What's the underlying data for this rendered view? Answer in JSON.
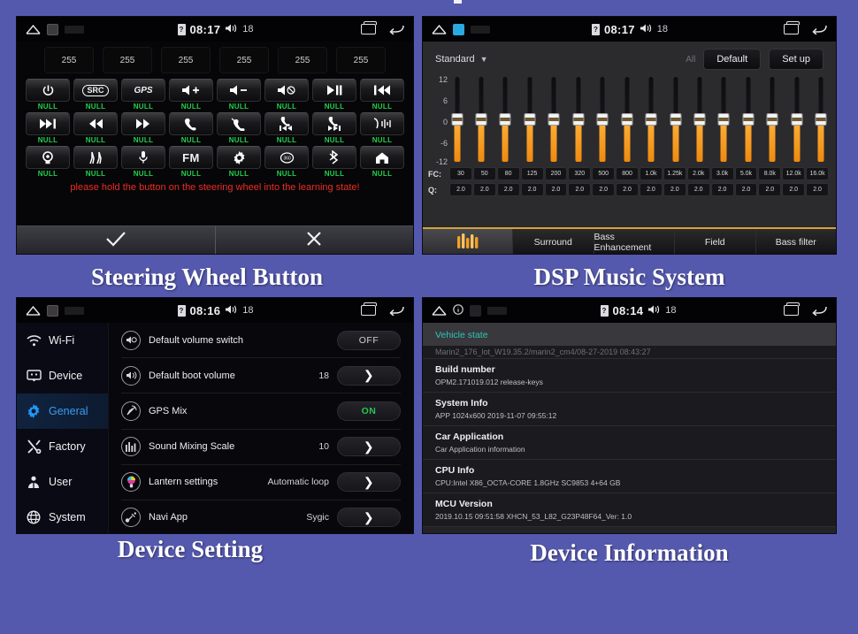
{
  "captions": {
    "steering": "Steering Wheel Button",
    "dsp": "DSP Music System",
    "setting": "Device Setting",
    "info": "Device  Information"
  },
  "status_bars": {
    "p1": {
      "time": "08:17",
      "volume": "18",
      "battery_icon": "battery-icon",
      "home_icon": "home-icon",
      "recent_icon": "recent-apps-icon",
      "back_icon": "back-icon"
    },
    "p2": {
      "time": "08:17",
      "volume": "18"
    },
    "p3": {
      "time": "08:16",
      "volume": "18"
    },
    "p4": {
      "time": "08:14",
      "volume": "18"
    }
  },
  "steering": {
    "values": [
      "255",
      "255",
      "255",
      "255",
      "255",
      "255"
    ],
    "hint": "please hold the button on the steering wheel into the learning state!",
    "null_label": "NULL",
    "buttons": [
      {
        "icon": "power-icon",
        "label": "NULL"
      },
      {
        "icon": "src-icon",
        "label": "NULL"
      },
      {
        "icon": "gps-icon",
        "label": "NULL"
      },
      {
        "icon": "volume-up-icon",
        "label": "NULL"
      },
      {
        "icon": "volume-down-icon",
        "label": "NULL"
      },
      {
        "icon": "volume-mute-icon",
        "label": "NULL"
      },
      {
        "icon": "play-pause-icon",
        "label": "NULL"
      },
      {
        "icon": "previous-track-icon",
        "label": "NULL"
      },
      {
        "icon": "next-track-icon",
        "label": "NULL"
      },
      {
        "icon": "rewind-icon",
        "label": "NULL"
      },
      {
        "icon": "fast-forward-icon",
        "label": "NULL"
      },
      {
        "icon": "phone-answer-icon",
        "label": "NULL"
      },
      {
        "icon": "phone-hangup-icon",
        "label": "NULL"
      },
      {
        "icon": "phone-prev-icon",
        "label": "NULL"
      },
      {
        "icon": "phone-next-icon",
        "label": "NULL"
      },
      {
        "icon": "voice-wave-icon",
        "label": "NULL"
      },
      {
        "icon": "camera-icon",
        "label": "NULL"
      },
      {
        "icon": "seat-icon",
        "label": "NULL"
      },
      {
        "icon": "microphone-icon",
        "label": "NULL"
      },
      {
        "icon": "fm-radio-icon",
        "label": "FM",
        "text": "FM"
      },
      {
        "icon": "settings-gear-icon",
        "label": "NULL"
      },
      {
        "icon": "360-view-icon",
        "label": "NULL"
      },
      {
        "icon": "bluetooth-icon",
        "label": "NULL"
      },
      {
        "icon": "home-house-icon",
        "label": "NULL"
      }
    ],
    "confirm_icon": "check-icon",
    "cancel_icon": "close-icon"
  },
  "dsp": {
    "preset": "Standard",
    "all_label": "All",
    "default_button": "Default",
    "setup_button": "Set up",
    "scale_labels": [
      "12",
      "6",
      "0",
      "-6",
      "-12"
    ],
    "fc_label": "FC:",
    "q_label": "Q:",
    "fc_values": [
      "30",
      "50",
      "80",
      "125",
      "200",
      "320",
      "500",
      "800",
      "1.0k",
      "1.25k",
      "2.0k",
      "3.0k",
      "5.0k",
      "8.0k",
      "12.0k",
      "16.0k"
    ],
    "q_values": [
      "2.0",
      "2.0",
      "2.0",
      "2.0",
      "2.0",
      "2.0",
      "2.0",
      "2.0",
      "2.0",
      "2.0",
      "2.0",
      "2.0",
      "2.0",
      "2.0",
      "2.0",
      "2.0"
    ],
    "band_gains": [
      0,
      0,
      0,
      0,
      0,
      0,
      0,
      0,
      0,
      0,
      0,
      0,
      0,
      0,
      0,
      0
    ],
    "tabs": [
      {
        "label": "",
        "icon": "equalizer-icon",
        "active": true
      },
      {
        "label": "Surround",
        "active": false
      },
      {
        "label": "Bass Enhancement",
        "active": false
      },
      {
        "label": "Field",
        "active": false
      },
      {
        "label": "Bass filter",
        "active": false
      }
    ]
  },
  "device_setting": {
    "sidebar": [
      {
        "label": "Wi-Fi",
        "icon": "wifi-icon",
        "active": false
      },
      {
        "label": "Device",
        "icon": "device-icon",
        "active": false
      },
      {
        "label": "General",
        "icon": "gear-icon",
        "active": true
      },
      {
        "label": "Factory",
        "icon": "tools-icon",
        "active": false
      },
      {
        "label": "User",
        "icon": "user-icon",
        "active": false
      },
      {
        "label": "System",
        "icon": "globe-icon",
        "active": false
      }
    ],
    "rows": [
      {
        "name": "Default volume switch",
        "icon": "volume-mute-circle-icon",
        "value": "",
        "control": "OFF"
      },
      {
        "name": "Default boot volume",
        "icon": "volume-circle-icon",
        "value": "18",
        "control": "chevron"
      },
      {
        "name": "GPS Mix",
        "icon": "gps-circle-icon",
        "value": "",
        "control": "ON"
      },
      {
        "name": "Sound Mixing Scale",
        "icon": "equalizer-circle-icon",
        "value": "10",
        "control": "chevron"
      },
      {
        "name": "Lantern settings",
        "icon": "lantern-circle-icon",
        "value": "Automatic loop",
        "control": "chevron"
      },
      {
        "name": "Navi App",
        "icon": "navi-circle-icon",
        "value": "Sygic",
        "control": "chevron"
      }
    ]
  },
  "device_info": {
    "header": "Vehicle state",
    "scrolled_line": "Marin2_176_lot_W19.35.2/marin2_cm4/08-27-2019 08:43:27",
    "rows": [
      {
        "title": "Build number",
        "subtitle": "OPM2.171019.012 release-keys"
      },
      {
        "title": "System Info",
        "subtitle": "APP 1024x600 2019-11-07 09:55:12"
      },
      {
        "title": "Car Application",
        "subtitle": "Car Application information"
      },
      {
        "title": "CPU Info",
        "subtitle": "CPU:Intel X86_OCTA-CORE 1.8GHz SC9853 4+64 GB"
      },
      {
        "title": "MCU Version",
        "subtitle": "2019.10.15 09:51:58 XHCN_53_L82_G23P48F64_Ver: 1.0"
      }
    ]
  },
  "colors": {
    "page_bg": "#5559ae",
    "accent_orange": "#f5a11f",
    "accent_blue": "#3d9bf0",
    "null_green": "#1fd34a",
    "warning_red": "#ee2b24",
    "teal": "#2fc6b5"
  }
}
